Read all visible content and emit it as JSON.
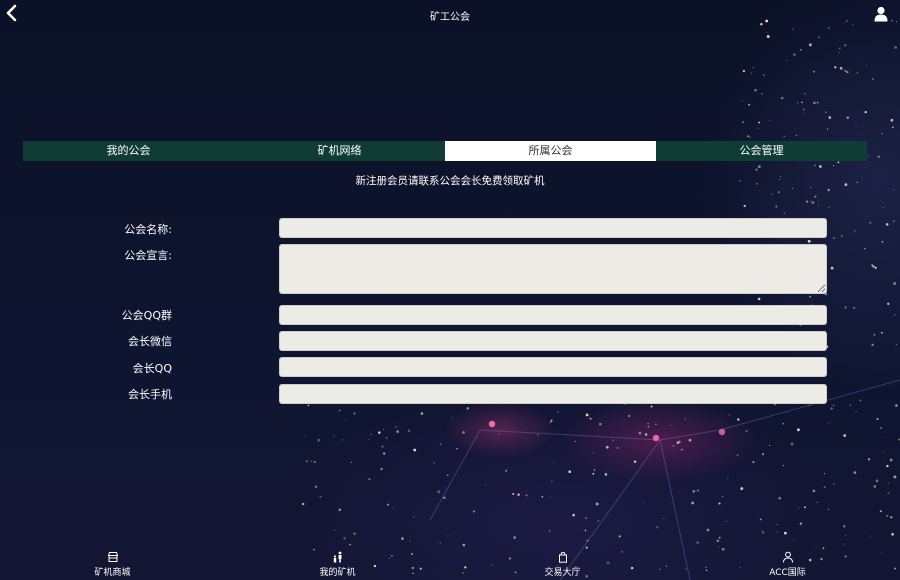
{
  "header": {
    "title": "矿工公会"
  },
  "tabs": [
    {
      "label": "我的公会"
    },
    {
      "label": "矿机网络"
    },
    {
      "label": "所属公会"
    },
    {
      "label": "公会管理"
    }
  ],
  "active_tab": 2,
  "notice": "新注册会员请联系公会会长免费领取矿机",
  "form": {
    "name_label": "公会名称:",
    "name_value": "",
    "declaration_label": "公会宣言:",
    "declaration_value": "",
    "qq_group_label": "公会QQ群",
    "qq_group_value": "",
    "wechat_label": "会长微信",
    "wechat_value": "",
    "qq_label": "会长QQ",
    "qq_value": "",
    "phone_label": "会长手机",
    "phone_value": ""
  },
  "bottom_nav": [
    {
      "label": "矿机商城",
      "icon": "store-icon"
    },
    {
      "label": "我的矿机",
      "icon": "miner-icon"
    },
    {
      "label": "交易大厅",
      "icon": "shopping-bag-icon"
    },
    {
      "label": "ACC国际",
      "icon": "user-icon"
    }
  ],
  "colors": {
    "tab_bar": "#0f3c35",
    "active_tab": "#ffffff",
    "field_bg": "#ecebe6"
  }
}
